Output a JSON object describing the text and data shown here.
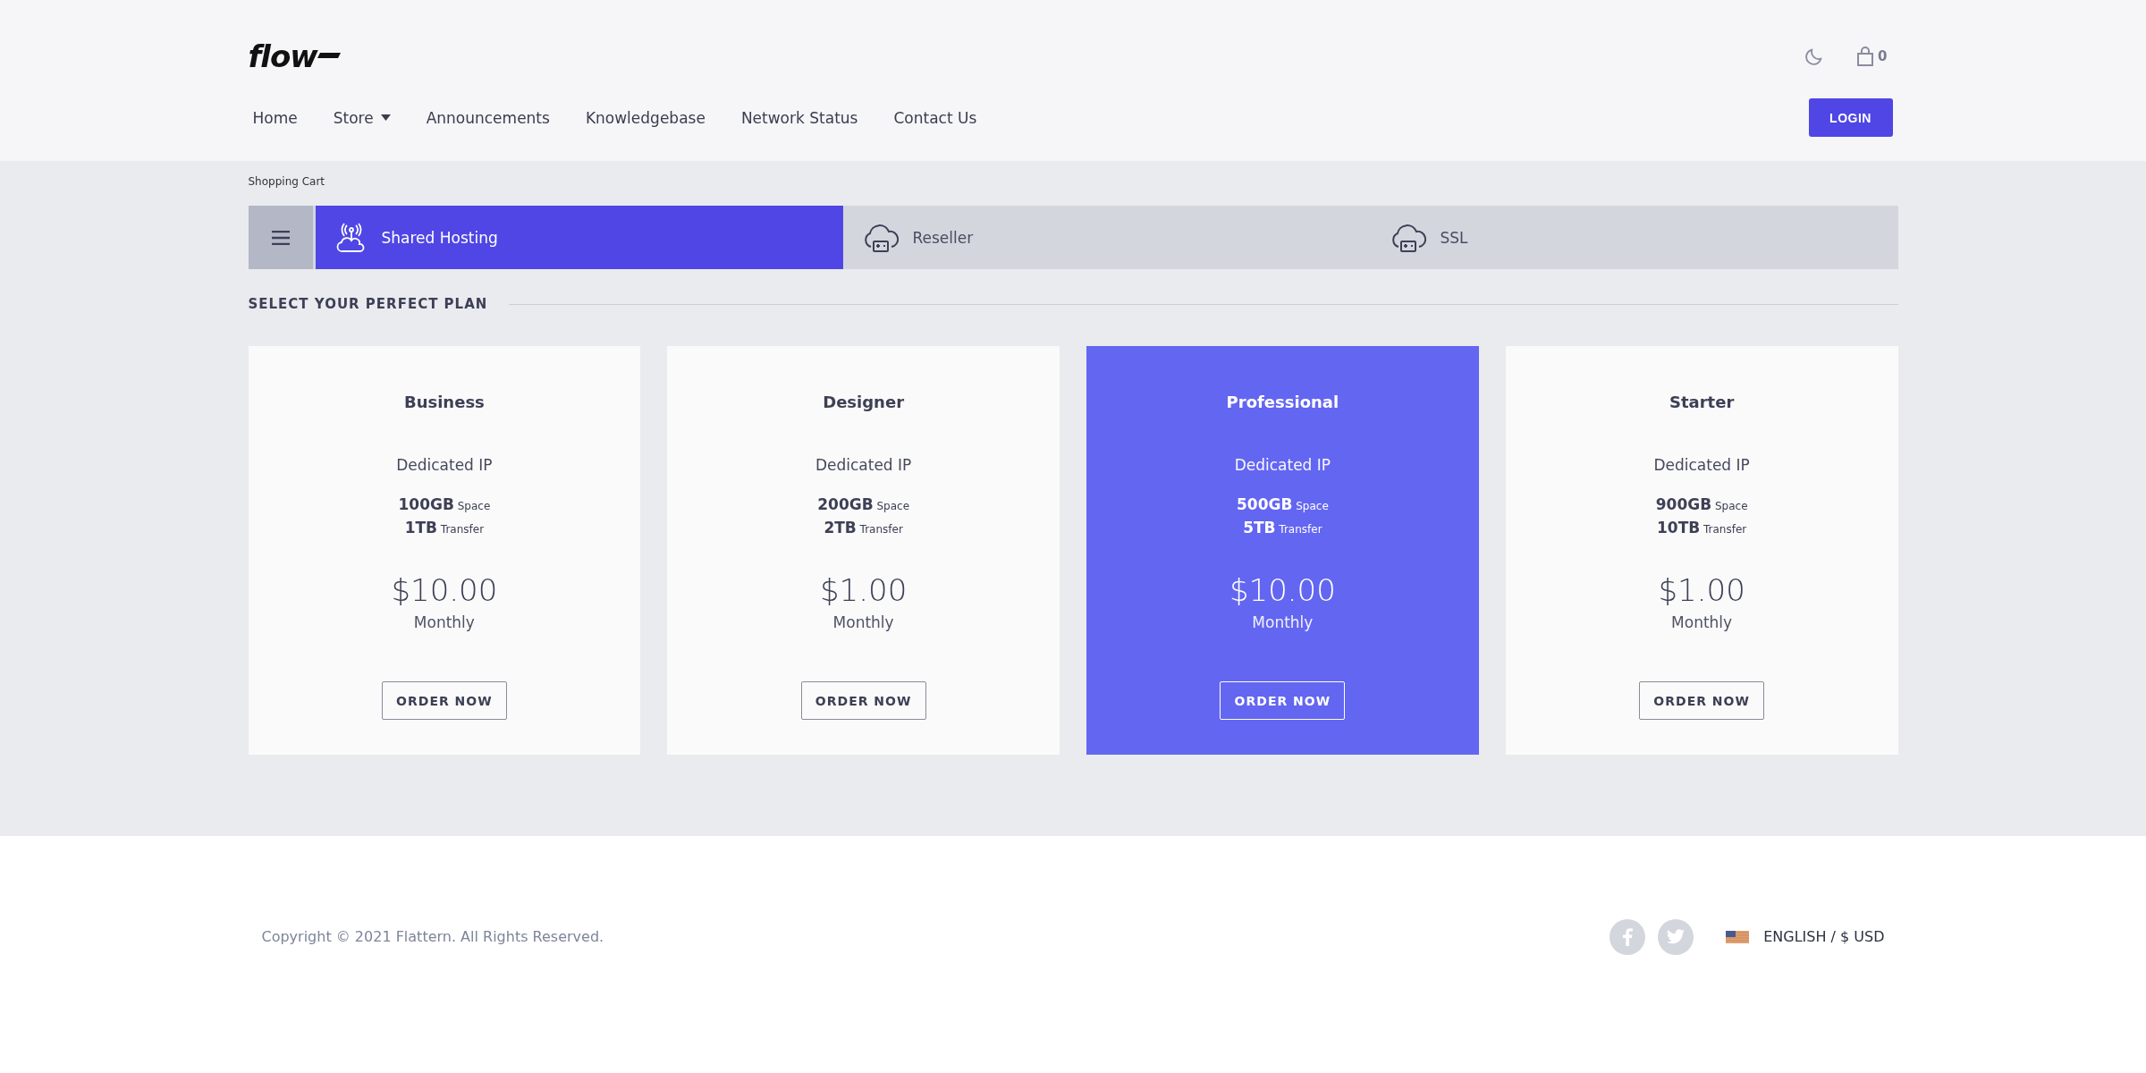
{
  "header": {
    "logo": "flow",
    "cart_count": "0",
    "login": "LOGIN"
  },
  "nav": [
    {
      "label": "Home",
      "dropdown": false
    },
    {
      "label": "Store",
      "dropdown": true
    },
    {
      "label": "Announcements",
      "dropdown": false
    },
    {
      "label": "Knowledgebase",
      "dropdown": false
    },
    {
      "label": "Network Status",
      "dropdown": false
    },
    {
      "label": "Contact Us",
      "dropdown": false
    }
  ],
  "breadcrumb": "Shopping Cart",
  "tabs": [
    {
      "label": "Shared Hosting",
      "selected": true
    },
    {
      "label": "Reseller",
      "selected": false
    },
    {
      "label": "SSL",
      "selected": false
    }
  ],
  "section_title": "SELECT YOUR PERFECT PLAN",
  "plans": [
    {
      "name": "Business",
      "feature": "Dedicated IP",
      "specs": [
        "**100GB** Space",
        "**1TB** Transfer"
      ],
      "price": "$10.00",
      "cycle": "Monthly",
      "button": "ORDER NOW",
      "selected": false
    },
    {
      "name": "Designer",
      "feature": "Dedicated IP",
      "specs": [
        "**200GB** Space",
        "**2TB** Transfer"
      ],
      "price": "$1.00",
      "cycle": "Monthly",
      "button": "ORDER NOW",
      "selected": false
    },
    {
      "name": "Professional",
      "feature": "Dedicated IP",
      "specs": [
        "**500GB** Space",
        "**5TB** Transfer"
      ],
      "price": "$10.00",
      "cycle": "Monthly",
      "button": "ORDER NOW",
      "selected": true
    },
    {
      "name": "Starter",
      "feature": "Dedicated IP",
      "specs": [
        "**900GB** Space",
        "**10TB** Transfer"
      ],
      "price": "$1.00",
      "cycle": "Monthly",
      "button": "ORDER NOW",
      "selected": false
    }
  ],
  "footer": {
    "copyright": "Copyright © 2021 Flattern. All Rights Reserved.",
    "language": "ENGLISH / $ USD"
  }
}
